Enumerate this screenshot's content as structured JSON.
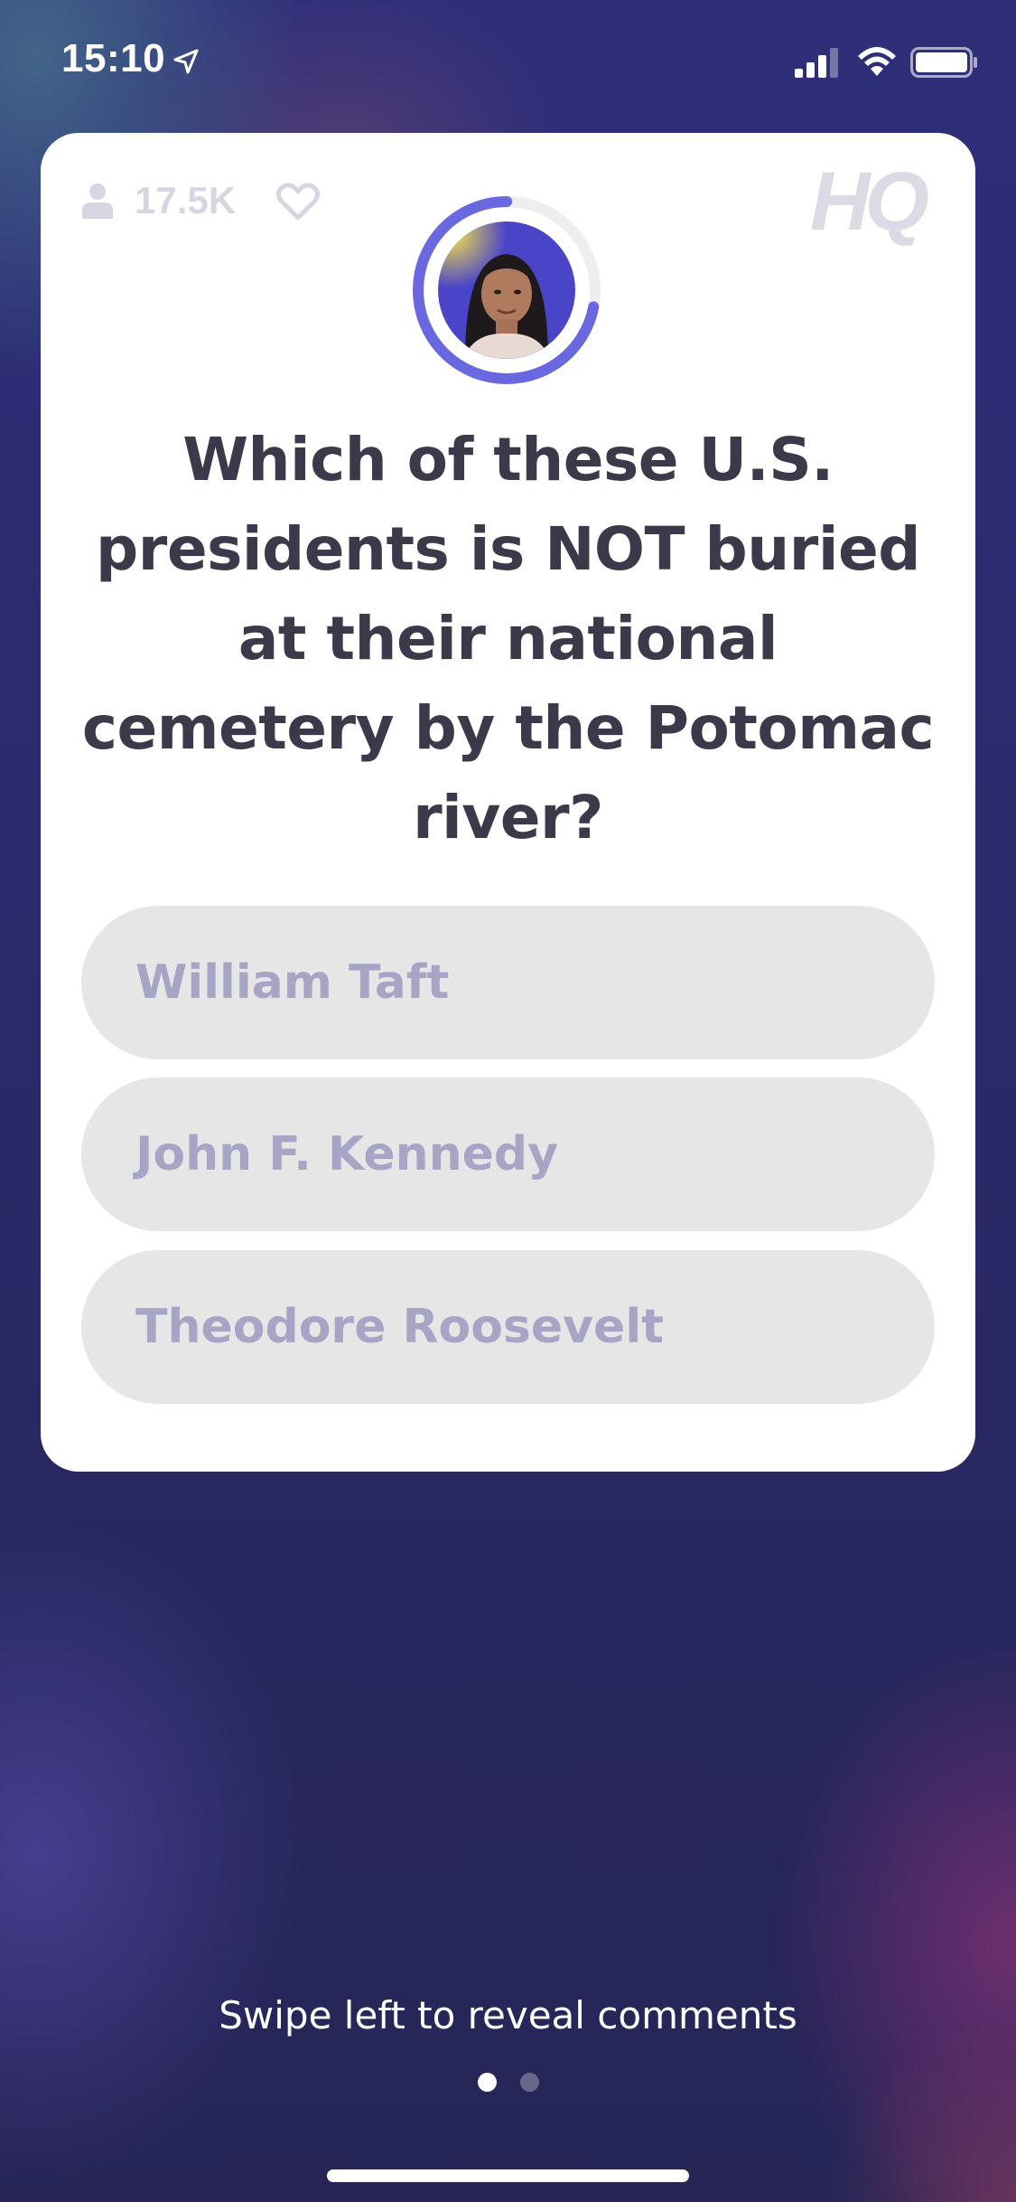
{
  "status_bar": {
    "time": "15:10",
    "icons": [
      "location-arrow-icon",
      "cellular-signal-icon",
      "wifi-icon",
      "battery-icon"
    ]
  },
  "card": {
    "viewer_count": "17.5K",
    "icons": [
      "person-icon",
      "heart-icon"
    ],
    "logo": "HQ",
    "timer_progress": 0.72,
    "question": "Which of these U.S. presidents is NOT buried at their national cemetery by the Potomac river?",
    "answers": [
      {
        "label": "William Taft"
      },
      {
        "label": "John F. Kennedy"
      },
      {
        "label": "Theodore Roosevelt"
      }
    ]
  },
  "footer": {
    "swipe_hint": "Swipe left to reveal comments",
    "page_count": 2,
    "active_page": 1
  },
  "colors": {
    "background": "#2b2a6c",
    "card": "#ffffff",
    "timer_ring": "#6a68e0",
    "answer_bg": "#e6e6e6",
    "answer_text": "#a7a5c6",
    "question_text": "#3a3a4a"
  }
}
